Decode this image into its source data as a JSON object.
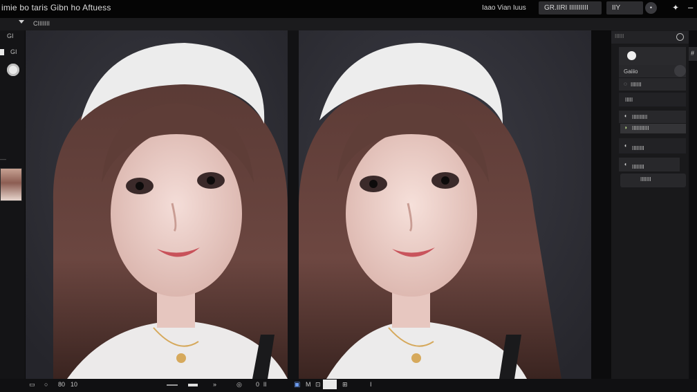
{
  "title_bar": {
    "app_title": "imie bo taris Gibn ho Aftuess",
    "menu_label": "Iaao Vian Iuus",
    "primary_button": "GR.IIRI IIIIIIIIII",
    "secondary_button": "IIY IIIIIIII",
    "circle_button": "•",
    "pin_icon": "✦",
    "minimize_icon": "–"
  },
  "options_bar": {
    "label": "CIIIIIII"
  },
  "left_toolbar": {
    "top_label": "GI",
    "second_label": "GI",
    "separator": "—"
  },
  "right_panel": {
    "header_label": "IIIIII",
    "items": [
      {
        "icon": "☐",
        "label": "Gaiiio"
      },
      {
        "icon": "◌",
        "label": "IIIIIII"
      },
      {
        "icon": "",
        "label": "IIIII"
      },
      {
        "icon": "◖",
        "label": "IIIIIIIIII"
      },
      {
        "icon": "◗",
        "label": "IIIIIIIIIII"
      },
      {
        "icon": "◖",
        "label": "IIIIIIII"
      },
      {
        "icon": "◖",
        "label": "IIIIIIII"
      },
      {
        "icon": "",
        "label": "IIIIIII"
      }
    ],
    "strip_label": "#"
  },
  "bottom_bar": {
    "items": [
      "▭",
      "○",
      "80",
      "10",
      "⌁",
      "▭",
      "»",
      "◎",
      "0",
      "lI",
      "▣",
      "M",
      "⊡",
      "⊞",
      "I"
    ]
  },
  "colors": {
    "canvas_bg": "#2c2c32",
    "panel_bg": "#19191b",
    "accent_blue": "#6e9cf0"
  }
}
